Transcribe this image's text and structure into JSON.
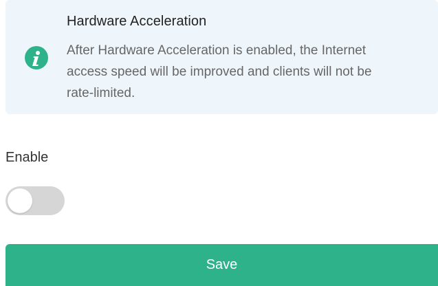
{
  "info": {
    "icon": "info-icon",
    "title": "Hardware Acceleration",
    "description": "After Hardware Acceleration is enabled, the Internet access speed will be improved and clients will not be rate-limited."
  },
  "enable": {
    "label": "Enable",
    "state": "off"
  },
  "actions": {
    "save_label": "Save"
  },
  "colors": {
    "accent": "#2eb28a",
    "info_background": "#eef5fb",
    "toggle_off": "#d6d6d6"
  }
}
